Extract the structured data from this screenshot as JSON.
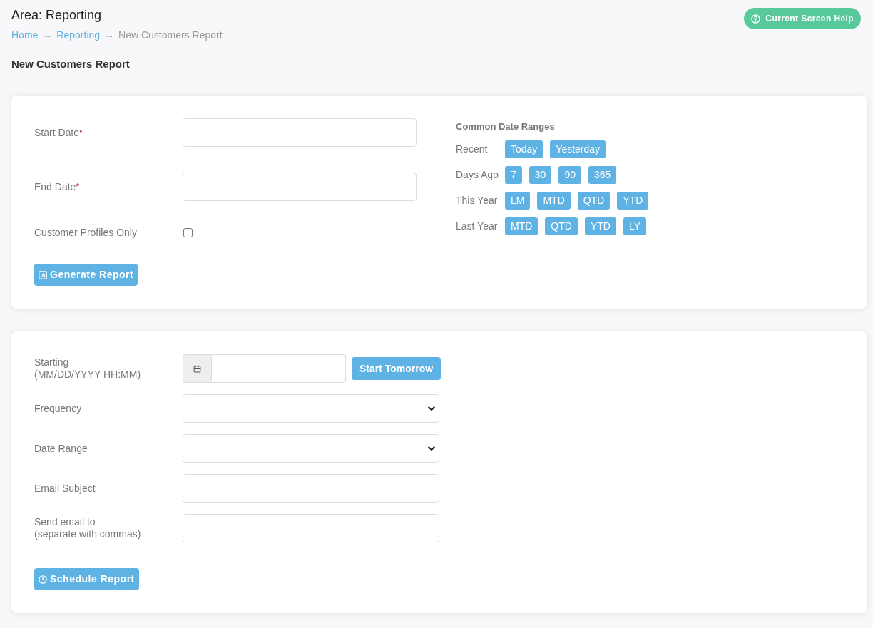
{
  "header": {
    "title": "Area: Reporting",
    "help_button": "Current Screen Help"
  },
  "breadcrumb": [
    {
      "kind": "link",
      "label": "Home"
    },
    {
      "kind": "separator",
      "label": "→"
    },
    {
      "kind": "link",
      "label": "Reporting"
    },
    {
      "kind": "separator",
      "label": "→"
    },
    {
      "kind": "current",
      "label": "New Customers Report"
    }
  ],
  "page_title": "New Customers Report",
  "report_form": {
    "fields": [
      {
        "kind": "text",
        "label": "Start Date",
        "required_mark": "*"
      },
      {
        "kind": "text",
        "label": "End Date",
        "required_mark": "*"
      },
      {
        "kind": "checkbox",
        "label": "Customer Profiles Only",
        "checked": false
      }
    ],
    "submit_button": "Generate Report"
  },
  "common_date_ranges": {
    "title": "Common Date Ranges",
    "groups": [
      {
        "label": "Recent",
        "buttons": [
          "Today",
          "Yesterday"
        ]
      },
      {
        "label": "Days Ago",
        "buttons": [
          "7",
          "30",
          "90",
          "365"
        ]
      },
      {
        "label": "This Year",
        "buttons": [
          "LM",
          "MTD",
          "QTD",
          "YTD"
        ]
      },
      {
        "label": "Last Year",
        "buttons": [
          "MTD",
          "QTD",
          "YTD",
          "LY"
        ]
      }
    ]
  },
  "schedule_form": {
    "fields": [
      {
        "kind": "datetime",
        "label": "Starting\n(MM/DD/YYYY HH:MM)",
        "button": "Start Tomorrow"
      },
      {
        "kind": "select",
        "label": "Frequency"
      },
      {
        "kind": "select",
        "label": "Date Range"
      },
      {
        "kind": "text",
        "label": "Email Subject"
      },
      {
        "kind": "text",
        "label": "Send email to\n(separate with commas)"
      }
    ],
    "submit_button": "Schedule Report"
  }
}
